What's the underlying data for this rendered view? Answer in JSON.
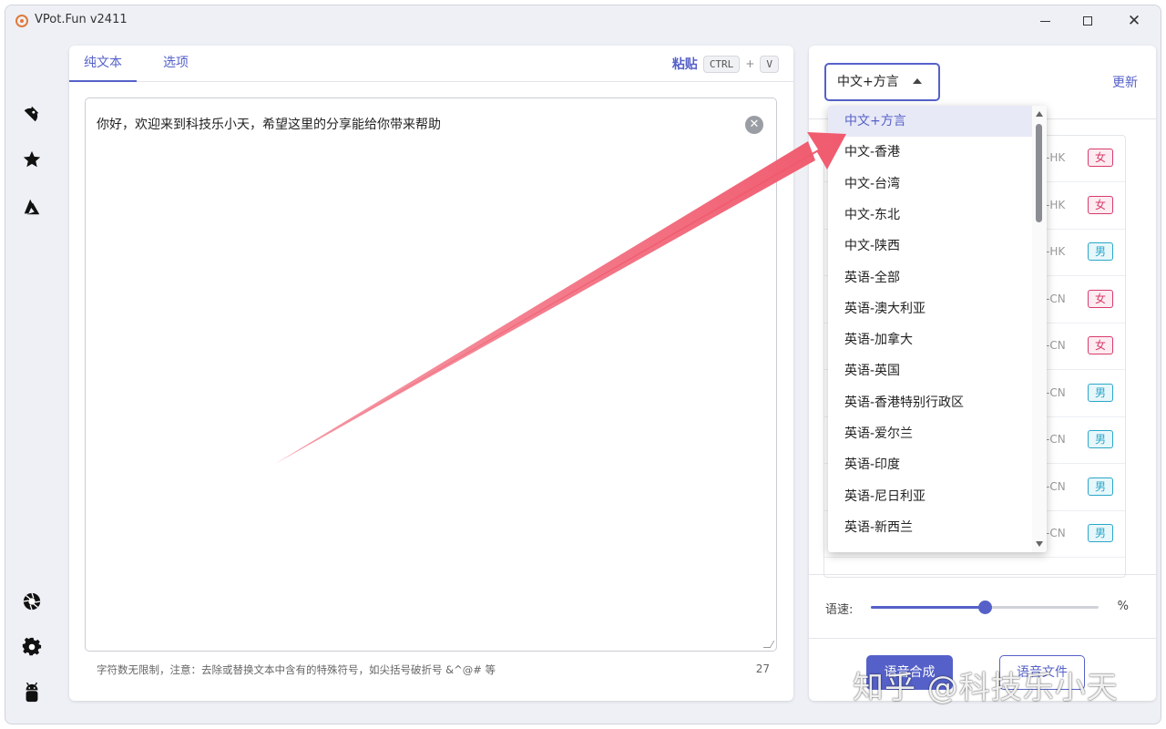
{
  "window": {
    "title": "VPot.Fun v2411",
    "controls": {
      "minimize": "minimize",
      "maximize": "maximize",
      "close": "✕"
    }
  },
  "rail": {
    "icons": [
      "voice-icon",
      "star-icon",
      "azure-icon",
      "aperture-icon",
      "gear-icon",
      "android-icon"
    ]
  },
  "editor": {
    "tabs": [
      "纯文本",
      "选项"
    ],
    "paste_label": "粘贴",
    "shortcut": {
      "key1": "CTRL",
      "plus": "+",
      "key2": "V"
    },
    "text": "你好，欢迎来到科技乐小天，希望这里的分享能给你带来帮助",
    "clear_icon": "✕",
    "footer_note": "字符数无限制，注意：去除或替换文本中含有的特殊符号，如尖括号破折号 &^@# 等",
    "char_count": "27"
  },
  "voice_panel": {
    "selected_language": "中文+方言",
    "update_label": "更新",
    "rows": [
      {
        "code": "-HK",
        "gender": "女",
        "gender_type": "female"
      },
      {
        "code": "-HK",
        "gender": "女",
        "gender_type": "female"
      },
      {
        "code": "-HK",
        "gender": "男",
        "gender_type": "male"
      },
      {
        "code": "-CN",
        "gender": "女",
        "gender_type": "female"
      },
      {
        "code": "-CN",
        "gender": "女",
        "gender_type": "female"
      },
      {
        "code": "-CN",
        "gender": "男",
        "gender_type": "male"
      },
      {
        "code": "-CN",
        "gender": "男",
        "gender_type": "male"
      },
      {
        "code": "-CN",
        "gender": "男",
        "gender_type": "male"
      },
      {
        "code": "-CN",
        "gender": "男",
        "gender_type": "male"
      }
    ],
    "speed_label": "语速:",
    "speed_value": 0.5,
    "percent_sign": "%",
    "synthesize_label": "语音合成",
    "file_label": "语音文件"
  },
  "dropdown": {
    "options": [
      "中文+方言",
      "中文-香港",
      "中文-台湾",
      "中文-东北",
      "中文-陕西",
      "英语-全部",
      "英语-澳大利亚",
      "英语-加拿大",
      "英语-英国",
      "英语-香港特别行政区",
      "英语-爱尔兰",
      "英语-印度",
      "英语-尼日利亚",
      "英语-新西兰"
    ],
    "selected_index": 0
  },
  "colors": {
    "accent": "#5561c8",
    "arrow": "#f05a6e",
    "female": "#d83b6a",
    "male": "#2aa7c9"
  },
  "watermark": "知乎 @科技乐小天"
}
